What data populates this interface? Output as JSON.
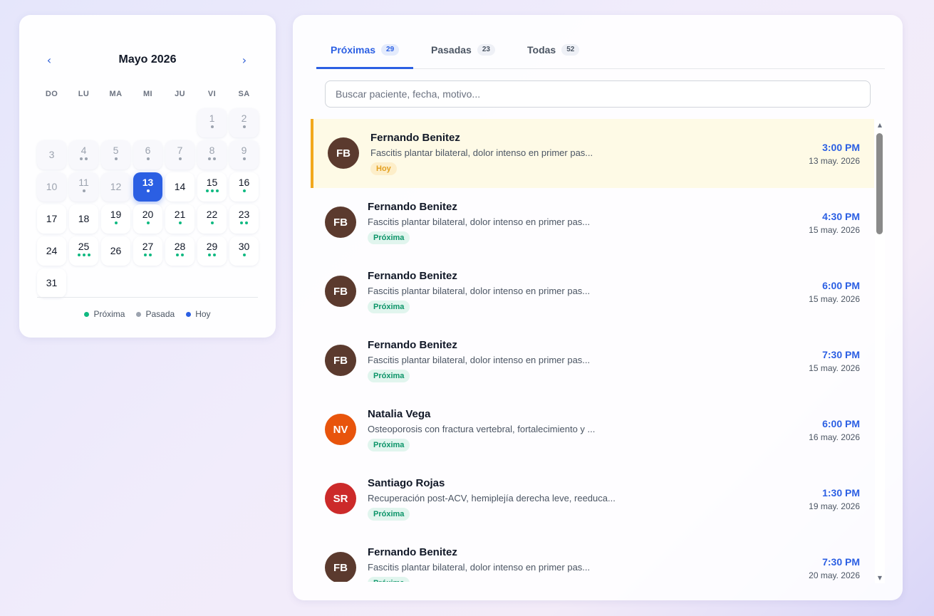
{
  "calendar": {
    "title": "Mayo 2026",
    "prev_label": "‹",
    "next_label": "›",
    "weekdays": [
      "DO",
      "LU",
      "MA",
      "MI",
      "JU",
      "VI",
      "SA"
    ],
    "days": [
      {
        "n": "1",
        "state": "past",
        "dots": [
          "past"
        ]
      },
      {
        "n": "2",
        "state": "past",
        "dots": [
          "past"
        ]
      },
      {
        "n": "3",
        "state": "past",
        "dots": []
      },
      {
        "n": "4",
        "state": "past",
        "dots": [
          "past",
          "past"
        ]
      },
      {
        "n": "5",
        "state": "past",
        "dots": [
          "past"
        ]
      },
      {
        "n": "6",
        "state": "past",
        "dots": [
          "past"
        ]
      },
      {
        "n": "7",
        "state": "past",
        "dots": [
          "past"
        ]
      },
      {
        "n": "8",
        "state": "past",
        "dots": [
          "past",
          "past"
        ]
      },
      {
        "n": "9",
        "state": "past",
        "dots": [
          "past"
        ]
      },
      {
        "n": "10",
        "state": "past",
        "dots": []
      },
      {
        "n": "11",
        "state": "past",
        "dots": [
          "past"
        ]
      },
      {
        "n": "12",
        "state": "past",
        "dots": []
      },
      {
        "n": "13",
        "state": "today",
        "dots": [
          "today"
        ]
      },
      {
        "n": "14",
        "state": "future",
        "dots": []
      },
      {
        "n": "15",
        "state": "future",
        "dots": [
          "up",
          "up",
          "up"
        ]
      },
      {
        "n": "16",
        "state": "future",
        "dots": [
          "up"
        ]
      },
      {
        "n": "17",
        "state": "future",
        "dots": []
      },
      {
        "n": "18",
        "state": "future",
        "dots": []
      },
      {
        "n": "19",
        "state": "future",
        "dots": [
          "up"
        ]
      },
      {
        "n": "20",
        "state": "future",
        "dots": [
          "up"
        ]
      },
      {
        "n": "21",
        "state": "future",
        "dots": [
          "up"
        ]
      },
      {
        "n": "22",
        "state": "future",
        "dots": [
          "up"
        ]
      },
      {
        "n": "23",
        "state": "future",
        "dots": [
          "up",
          "up"
        ]
      },
      {
        "n": "24",
        "state": "future",
        "dots": []
      },
      {
        "n": "25",
        "state": "future",
        "dots": [
          "up",
          "up",
          "up"
        ]
      },
      {
        "n": "26",
        "state": "future",
        "dots": []
      },
      {
        "n": "27",
        "state": "future",
        "dots": [
          "up",
          "up"
        ]
      },
      {
        "n": "28",
        "state": "future",
        "dots": [
          "up",
          "up"
        ]
      },
      {
        "n": "29",
        "state": "future",
        "dots": [
          "up",
          "up"
        ]
      },
      {
        "n": "30",
        "state": "future",
        "dots": [
          "up"
        ]
      },
      {
        "n": "31",
        "state": "future",
        "dots": []
      }
    ],
    "first_weekday_index": 5,
    "legend": [
      {
        "label": "Próxima",
        "color": "#10b981"
      },
      {
        "label": "Pasada",
        "color": "#9ca3af"
      },
      {
        "label": "Hoy",
        "color": "#2b5fe3"
      }
    ]
  },
  "tabs": [
    {
      "label": "Próximas",
      "count": "29",
      "active": true
    },
    {
      "label": "Pasadas",
      "count": "23",
      "active": false
    },
    {
      "label": "Todas",
      "count": "52",
      "active": false
    }
  ],
  "search": {
    "placeholder": "Buscar paciente, fecha, motivo...",
    "value": ""
  },
  "appointments": [
    {
      "initials": "FB",
      "name": "Fernando Benitez",
      "reason": "Fascitis plantar bilateral, dolor intenso en primer pas...",
      "badge": "Hoy",
      "badge_type": "today",
      "time": "3:00 PM",
      "date": "13 may. 2026",
      "avatar_color": "#5b3a2e",
      "highlight": true
    },
    {
      "initials": "FB",
      "name": "Fernando Benitez",
      "reason": "Fascitis plantar bilateral, dolor intenso en primer pas...",
      "badge": "Próxima",
      "badge_type": "up",
      "time": "4:30 PM",
      "date": "15 may. 2026",
      "avatar_color": "#5b3a2e",
      "highlight": false
    },
    {
      "initials": "FB",
      "name": "Fernando Benitez",
      "reason": "Fascitis plantar bilateral, dolor intenso en primer pas...",
      "badge": "Próxima",
      "badge_type": "up",
      "time": "6:00 PM",
      "date": "15 may. 2026",
      "avatar_color": "#5b3a2e",
      "highlight": false
    },
    {
      "initials": "FB",
      "name": "Fernando Benitez",
      "reason": "Fascitis plantar bilateral, dolor intenso en primer pas...",
      "badge": "Próxima",
      "badge_type": "up",
      "time": "7:30 PM",
      "date": "15 may. 2026",
      "avatar_color": "#5b3a2e",
      "highlight": false
    },
    {
      "initials": "NV",
      "name": "Natalia Vega",
      "reason": "Osteoporosis con fractura vertebral, fortalecimiento y ...",
      "badge": "Próxima",
      "badge_type": "up",
      "time": "6:00 PM",
      "date": "16 may. 2026",
      "avatar_color": "#e8540c",
      "highlight": false
    },
    {
      "initials": "SR",
      "name": "Santiago Rojas",
      "reason": "Recuperación post-ACV, hemiplejía derecha leve, reeduca...",
      "badge": "Próxima",
      "badge_type": "up",
      "time": "1:30 PM",
      "date": "19 may. 2026",
      "avatar_color": "#cc2a2a",
      "highlight": false
    },
    {
      "initials": "FB",
      "name": "Fernando Benitez",
      "reason": "Fascitis plantar bilateral, dolor intenso en primer pas...",
      "badge": "Próxima",
      "badge_type": "up",
      "time": "7:30 PM",
      "date": "20 may. 2026",
      "avatar_color": "#5b3a2e",
      "highlight": false
    }
  ],
  "scrollbar": {
    "up_icon": "▲",
    "down_icon": "▼"
  }
}
